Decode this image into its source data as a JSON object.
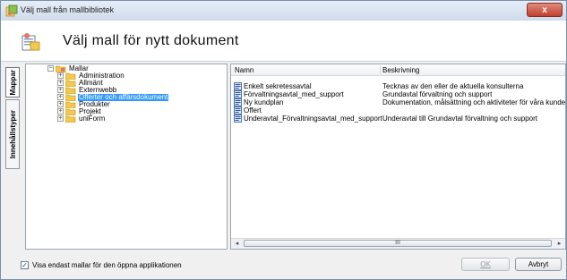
{
  "window": {
    "title": "Välj mall från mallbibliotek",
    "close_glyph": "x"
  },
  "header": {
    "title": "Välj mall för nytt dokument"
  },
  "side_tabs": [
    {
      "label": "Mappar",
      "active": true
    },
    {
      "label": "Innehållstyper",
      "active": false
    }
  ],
  "tree": {
    "root": {
      "label": "Mallar",
      "expanded": true
    },
    "items": [
      {
        "label": "Administration",
        "selected": false
      },
      {
        "label": "Allmänt",
        "selected": false
      },
      {
        "label": "Externwebb",
        "selected": false
      },
      {
        "label": "Offerter och affärsdokument",
        "selected": true
      },
      {
        "label": "Produkter",
        "selected": false
      },
      {
        "label": "Projekt",
        "selected": false
      },
      {
        "label": "uniForm",
        "selected": false
      }
    ]
  },
  "list": {
    "columns": {
      "name": "Namn",
      "description": "Beskrivning"
    },
    "rows": [
      {
        "name": "Enkelt sekretessavtal",
        "description": "Tecknas av den eller de aktuella konsulterna"
      },
      {
        "name": "Förvaltningsavtal_med_support",
        "description": "Grundavtal förvaltning och support"
      },
      {
        "name": "Ny kundplan",
        "description": "Dokumentation, målsättning och aktiviteter för våra kunder"
      },
      {
        "name": "Offert",
        "description": ""
      },
      {
        "name": "Underavtal_Förvaltningsavtal_med_support",
        "description": "Underavtal till Grundavtal förvaltning och support"
      }
    ],
    "scrollbar_grip": "III"
  },
  "footer": {
    "checkbox_label": "Visa endast mallar för den öppna applikationen",
    "checkbox_checked": true,
    "ok_label": "OK",
    "cancel_label": "Avbryt"
  },
  "colors": {
    "selection": "#3399ff",
    "folder": "#f2c94c",
    "close_button": "#c2402e"
  }
}
